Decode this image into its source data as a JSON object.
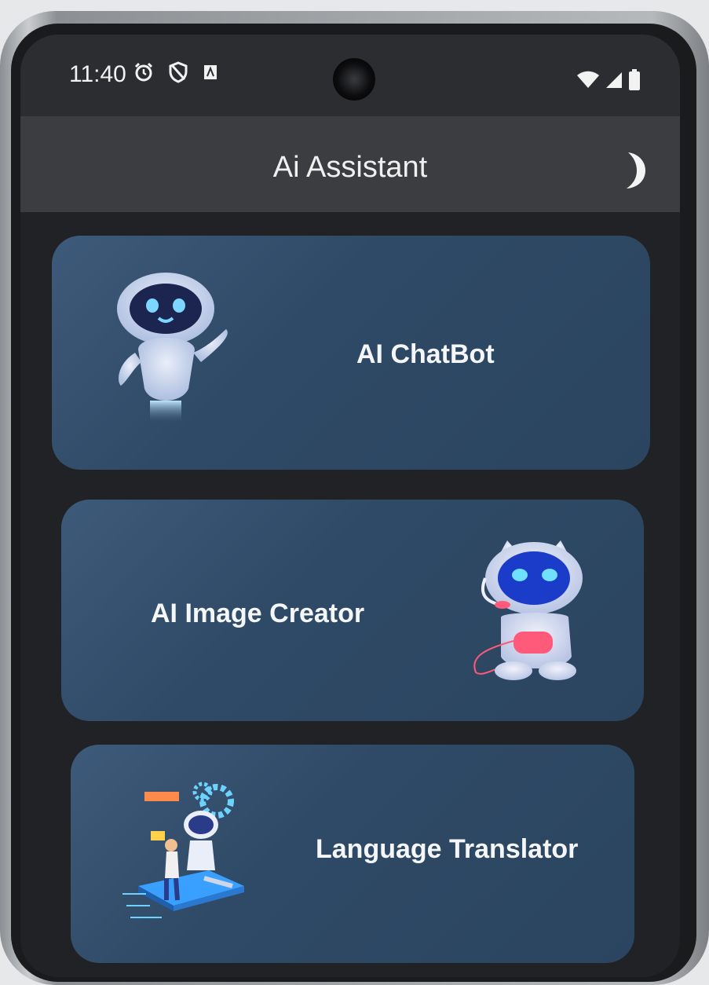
{
  "status_bar": {
    "time": "11:40",
    "left_icons": [
      "alarm-icon",
      "shield-icon",
      "notification-icon"
    ],
    "right_icons": [
      "wifi-icon",
      "signal-icon",
      "battery-icon"
    ]
  },
  "app_bar": {
    "title": "Ai Assistant",
    "theme_toggle_icon": "moon-icon"
  },
  "cards": [
    {
      "label": "AI ChatBot",
      "illustration": "robot-waving-illustration"
    },
    {
      "label": "AI Image Creator",
      "illustration": "robot-headset-illustration"
    },
    {
      "label": "Language Translator",
      "illustration": "translator-illustration"
    }
  ],
  "colors": {
    "screen_background": "#202225",
    "app_bar_background": "#3b3d40",
    "card_background": "#34506e",
    "text": "#f4f6f8"
  }
}
